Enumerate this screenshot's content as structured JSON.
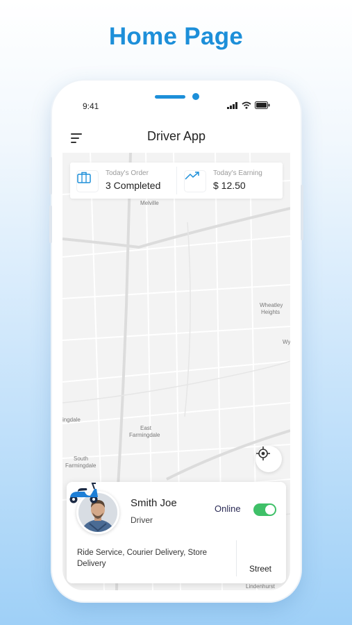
{
  "promo": {
    "title": "Home Page"
  },
  "status_bar": {
    "time": "9:41"
  },
  "header": {
    "title": "Driver App",
    "menu_icon": "hamburger-menu-icon"
  },
  "stats": {
    "orders": {
      "caption": "Today's Order",
      "value": "3 Completed",
      "icon": "briefcase-icon"
    },
    "earning": {
      "caption": "Today's Earning",
      "value": "$ 12.50",
      "icon": "trending-up-icon"
    }
  },
  "map": {
    "labels": [
      "Melville",
      "Wheatley",
      "Heights",
      "Wy",
      "ingdale",
      "East",
      "Farmingdale",
      "South",
      "Farmingdale",
      "Lindenhurst"
    ]
  },
  "driver": {
    "name": "Smith Joe",
    "role": "Driver",
    "status_label": "Online",
    "online": true,
    "services": "Ride Service, Courier Delivery, Store Delivery",
    "vehicle_label": "Street",
    "vehicle_icon": "scooter-icon"
  },
  "colors": {
    "accent": "#1d8fd9",
    "online": "#3fc068",
    "scooter": "#1e7fd6"
  }
}
